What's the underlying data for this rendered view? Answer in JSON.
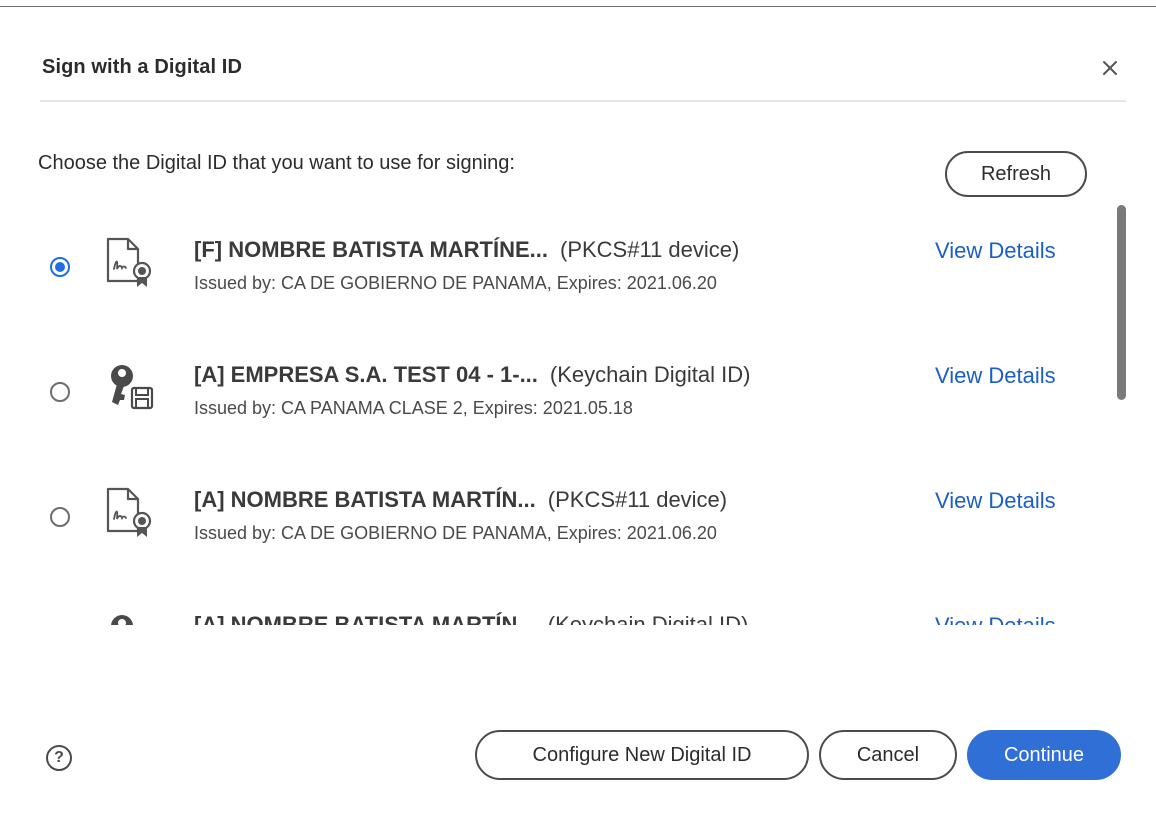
{
  "dialog": {
    "title": "Sign with a Digital ID",
    "prompt": "Choose the Digital ID that you want to use for signing:",
    "refresh_label": "Refresh",
    "close_icon": "close-icon"
  },
  "ids": [
    {
      "name": "[F] NOMBRE BATISTA MARTÍNE...",
      "type": "(PKCS#11 device)",
      "issued": "Issued by: CA DE GOBIERNO DE PANAMA, Expires: 2021.06.20",
      "details_label": "View Details",
      "selected": true,
      "icon": "certificate-icon"
    },
    {
      "name": "[A] EMPRESA S.A. TEST 04 - 1-...",
      "type": "(Keychain Digital ID)",
      "issued": "Issued by: CA PANAMA CLASE 2, Expires: 2021.05.18",
      "details_label": "View Details",
      "selected": false,
      "icon": "key-icon"
    },
    {
      "name": "[A] NOMBRE BATISTA MARTÍN...",
      "type": "(PKCS#11 device)",
      "issued": "Issued by: CA DE GOBIERNO DE PANAMA, Expires: 2021.06.20",
      "details_label": "View Details",
      "selected": false,
      "icon": "certificate-icon"
    },
    {
      "name": "[A] NOMBRE BATISTA MARTÍN...",
      "type": "(Keychain Digital ID)",
      "issued": "",
      "details_label": "View Details",
      "selected": false,
      "icon": "key-icon"
    }
  ],
  "footer": {
    "help_label": "?",
    "configure_label": "Configure New Digital ID",
    "cancel_label": "Cancel",
    "continue_label": "Continue"
  },
  "colors": {
    "accent": "#2f6fd6",
    "link": "#1a5fc6"
  }
}
